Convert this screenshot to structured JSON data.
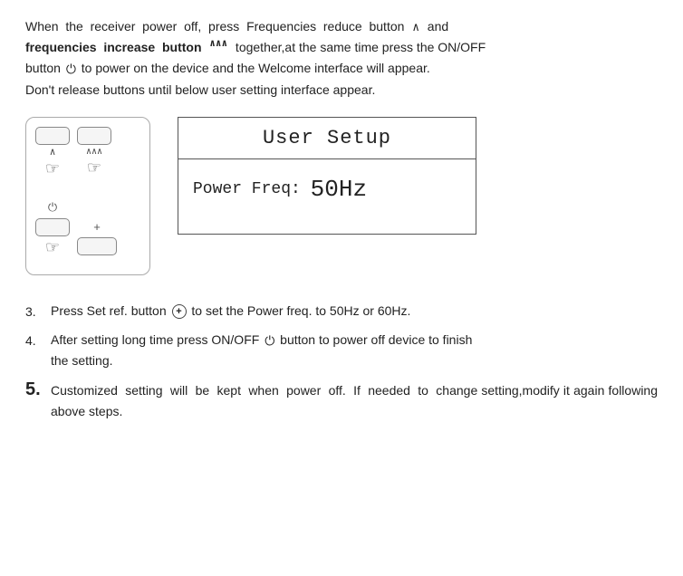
{
  "intro": {
    "line1": "When  the  receiver  power  off,  press  Frequencies  reduce  button",
    "line1b": "and",
    "line2_bold": "frequencies  increase  button",
    "line2_rest": "together,at the same time press the ON/OFF",
    "line3": "button",
    "line3_rest": "to power on the device and the Welcome interface will appear.",
    "line4": "Don't release buttons until below user setting interface appear."
  },
  "setup_box": {
    "title": "User Setup",
    "power_freq_label": "Power Freq:",
    "power_freq_value": "50Hz"
  },
  "steps": [
    {
      "num": "3.",
      "text": "Press Set ref. button",
      "text_rest": "to set the Power freq. to 50Hz or 60Hz.",
      "large": false
    },
    {
      "num": "4.",
      "text": "After setting long time press ON/OFF",
      "text_rest": "button to power off device to finish the setting.",
      "large": false
    },
    {
      "num": "5.",
      "text": "Customized  setting  will  be  kept  when  power  off.  If  needed  to  change setting,modify it again following above steps.",
      "large": true
    }
  ],
  "icons": {
    "reduce_wave": "∧",
    "increase_wave": "⋮∧⋮",
    "plus_circle": "+",
    "power_symbol": "⏻"
  }
}
